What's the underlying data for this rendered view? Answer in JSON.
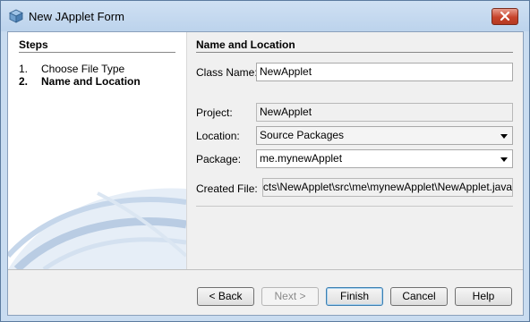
{
  "window": {
    "title": "New JApplet Form"
  },
  "steps": {
    "heading": "Steps",
    "items": [
      {
        "num": "1.",
        "label": "Choose File Type",
        "current": false
      },
      {
        "num": "2.",
        "label": "Name and Location",
        "current": true
      }
    ]
  },
  "panel": {
    "heading": "Name and Location",
    "class_name": {
      "label": "Class Name:",
      "value": "NewApplet"
    },
    "project": {
      "label": "Project:",
      "value": "NewApplet"
    },
    "location": {
      "label": "Location:",
      "value": "Source Packages"
    },
    "package": {
      "label": "Package:",
      "value": "me.mynewApplet"
    },
    "created_file": {
      "label": "Created File:",
      "value": "NetBeansProjects\\NewApplet\\src\\me\\mynewApplet\\NewApplet.java"
    }
  },
  "buttons": {
    "back": "< Back",
    "next": "Next >",
    "finish": "Finish",
    "cancel": "Cancel",
    "help": "Help"
  },
  "colors": {
    "accent": "#3c7fb1",
    "titlebar": "#c9dcf0",
    "close": "#c7432b"
  }
}
